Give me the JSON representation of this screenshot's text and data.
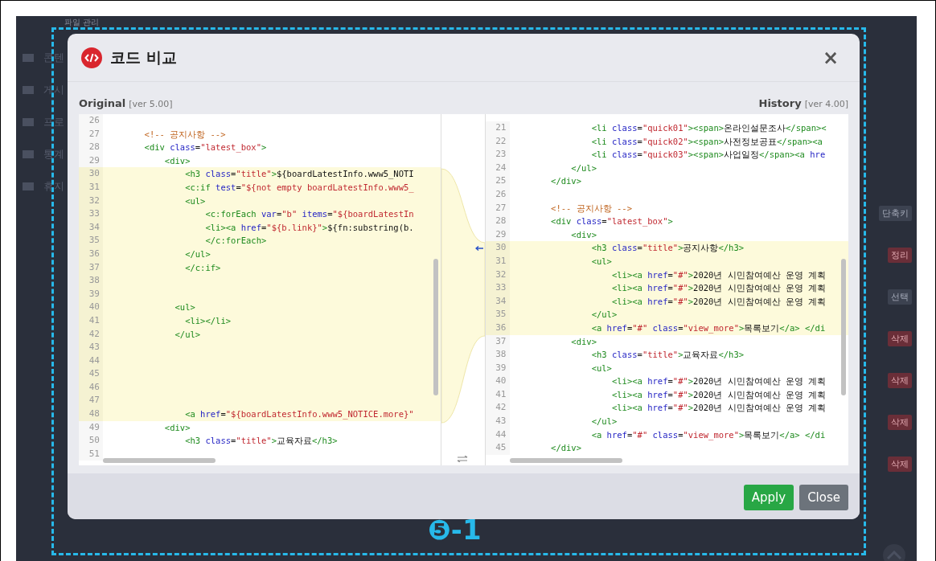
{
  "background": {
    "breadcrumb": "파일 관리",
    "sidebar": [
      {
        "label": "콘텐"
      },
      {
        "label": "게시"
      },
      {
        "label": "프로"
      },
      {
        "label": "통계"
      },
      {
        "label": "휴지"
      }
    ],
    "badges": [
      {
        "label": "단축키",
        "kind": "neutral"
      },
      {
        "label": "정리",
        "kind": "danger"
      },
      {
        "label": "선택",
        "kind": "neutral"
      },
      {
        "label": "삭제",
        "kind": "danger"
      },
      {
        "label": "삭제",
        "kind": "danger"
      },
      {
        "label": "삭제",
        "kind": "danger"
      },
      {
        "label": "삭제",
        "kind": "danger"
      }
    ]
  },
  "dialog": {
    "title": "코드 비교",
    "close": "×",
    "panes": [
      {
        "title": "Original",
        "version": "[ver 5.00]",
        "lines": [
          {
            "num": "26",
            "changed": false
          },
          {
            "num": "27",
            "changed": false,
            "tokens": [
              {
                "kind": "cmt",
                "s": "        <!-- 공지사항 -->"
              }
            ]
          },
          {
            "num": "28",
            "changed": false,
            "tokens": [
              {
                "kind": "tag",
                "s": "        <div "
              },
              {
                "kind": "attr",
                "s": "class"
              },
              {
                "kind": "txt",
                "s": "="
              },
              {
                "kind": "str",
                "s": "\"latest_box\""
              },
              {
                "kind": "tag",
                "s": ">"
              }
            ]
          },
          {
            "num": "29",
            "changed": false,
            "tokens": [
              {
                "kind": "tag",
                "s": "            <div>"
              }
            ]
          },
          {
            "num": "30",
            "changed": true,
            "tokens": [
              {
                "kind": "tag",
                "s": "                <h3 "
              },
              {
                "kind": "attr",
                "s": "class"
              },
              {
                "kind": "txt",
                "s": "="
              },
              {
                "kind": "str",
                "s": "\"title\""
              },
              {
                "kind": "tag",
                "s": ">"
              },
              {
                "kind": "txt",
                "s": "${boardLatestInfo.www5_NOTI"
              }
            ]
          },
          {
            "num": "31",
            "changed": true,
            "tokens": [
              {
                "kind": "tag",
                "s": "                <c:if "
              },
              {
                "kind": "attr",
                "s": "test"
              },
              {
                "kind": "txt",
                "s": "="
              },
              {
                "kind": "str",
                "s": "\"${not empty boardLatestInfo.www5_"
              }
            ]
          },
          {
            "num": "32",
            "changed": true,
            "tokens": [
              {
                "kind": "tag",
                "s": "                <ul>"
              }
            ]
          },
          {
            "num": "33",
            "changed": true,
            "tokens": [
              {
                "kind": "tag",
                "s": "                    <c:forEach "
              },
              {
                "kind": "attr",
                "s": "var"
              },
              {
                "kind": "txt",
                "s": "="
              },
              {
                "kind": "str",
                "s": "\"b\" "
              },
              {
                "kind": "attr",
                "s": "items"
              },
              {
                "kind": "txt",
                "s": "="
              },
              {
                "kind": "str",
                "s": "\"${boardLatestIn"
              }
            ]
          },
          {
            "num": "34",
            "changed": true,
            "tokens": [
              {
                "kind": "tag",
                "s": "                    <li><a "
              },
              {
                "kind": "attr",
                "s": "href"
              },
              {
                "kind": "txt",
                "s": "="
              },
              {
                "kind": "str",
                "s": "\"${b.link}\""
              },
              {
                "kind": "tag",
                "s": ">"
              },
              {
                "kind": "txt",
                "s": "${fn:substring(b."
              }
            ]
          },
          {
            "num": "35",
            "changed": true,
            "tokens": [
              {
                "kind": "tag",
                "s": "                    </c:forEach>"
              }
            ]
          },
          {
            "num": "36",
            "changed": true,
            "tokens": [
              {
                "kind": "tag",
                "s": "                </ul>"
              }
            ]
          },
          {
            "num": "37",
            "changed": true,
            "tokens": [
              {
                "kind": "tag",
                "s": "                </c:if>"
              }
            ]
          },
          {
            "num": "38",
            "changed": true
          },
          {
            "num": "39",
            "changed": true
          },
          {
            "num": "40",
            "changed": true,
            "tokens": [
              {
                "kind": "tag",
                "s": "              <ul>"
              }
            ]
          },
          {
            "num": "41",
            "changed": true,
            "tokens": [
              {
                "kind": "tag",
                "s": "                <li></li>"
              }
            ]
          },
          {
            "num": "42",
            "changed": true,
            "tokens": [
              {
                "kind": "tag",
                "s": "              </ul>"
              }
            ]
          },
          {
            "num": "43",
            "changed": true
          },
          {
            "num": "44",
            "changed": true
          },
          {
            "num": "45",
            "changed": true
          },
          {
            "num": "46",
            "changed": true
          },
          {
            "num": "47",
            "changed": true
          },
          {
            "num": "48",
            "changed": true,
            "tokens": [
              {
                "kind": "tag",
                "s": "                <a "
              },
              {
                "kind": "attr",
                "s": "href"
              },
              {
                "kind": "txt",
                "s": "="
              },
              {
                "kind": "str",
                "s": "\"${boardLatestInfo.www5_NOTICE.more}\""
              }
            ]
          },
          {
            "num": "49",
            "changed": false,
            "tokens": [
              {
                "kind": "tag",
                "s": "            <div>"
              }
            ]
          },
          {
            "num": "50",
            "changed": false,
            "tokens": [
              {
                "kind": "tag",
                "s": "                <h3 "
              },
              {
                "kind": "attr",
                "s": "class"
              },
              {
                "kind": "txt",
                "s": "="
              },
              {
                "kind": "str",
                "s": "\"title\""
              },
              {
                "kind": "tag",
                "s": ">"
              },
              {
                "kind": "txt",
                "s": "교육자료"
              },
              {
                "kind": "tag",
                "s": "</h3>"
              }
            ]
          },
          {
            "num": "51",
            "changed": false
          }
        ]
      },
      {
        "title": "History",
        "version": "[ver 4.00]",
        "lines": [
          {
            "num": "21",
            "changed": false,
            "tokens": [
              {
                "kind": "tag",
                "s": "                <li "
              },
              {
                "kind": "attr",
                "s": "class"
              },
              {
                "kind": "txt",
                "s": "="
              },
              {
                "kind": "str",
                "s": "\"quick01\""
              },
              {
                "kind": "tag",
                "s": "><span>"
              },
              {
                "kind": "txt",
                "s": "온라인설문조사"
              },
              {
                "kind": "tag",
                "s": "</span><"
              }
            ]
          },
          {
            "num": "22",
            "changed": false,
            "tokens": [
              {
                "kind": "tag",
                "s": "                <li "
              },
              {
                "kind": "attr",
                "s": "class"
              },
              {
                "kind": "txt",
                "s": "="
              },
              {
                "kind": "str",
                "s": "\"quick02\""
              },
              {
                "kind": "tag",
                "s": "><span>"
              },
              {
                "kind": "txt",
                "s": "사전정보공표"
              },
              {
                "kind": "tag",
                "s": "</span><a"
              }
            ]
          },
          {
            "num": "23",
            "changed": false,
            "tokens": [
              {
                "kind": "tag",
                "s": "                <li "
              },
              {
                "kind": "attr",
                "s": "class"
              },
              {
                "kind": "txt",
                "s": "="
              },
              {
                "kind": "str",
                "s": "\"quick03\""
              },
              {
                "kind": "tag",
                "s": "><span>"
              },
              {
                "kind": "txt",
                "s": "사업일정"
              },
              {
                "kind": "tag",
                "s": "</span><a "
              },
              {
                "kind": "attr",
                "s": "hre"
              }
            ]
          },
          {
            "num": "24",
            "changed": false,
            "tokens": [
              {
                "kind": "tag",
                "s": "            </ul>"
              }
            ]
          },
          {
            "num": "25",
            "changed": false,
            "tokens": [
              {
                "kind": "tag",
                "s": "        </div>"
              }
            ]
          },
          {
            "num": "26",
            "changed": false
          },
          {
            "num": "27",
            "changed": false,
            "tokens": [
              {
                "kind": "cmt",
                "s": "        <!-- 공지사항 -->"
              }
            ]
          },
          {
            "num": "28",
            "changed": false,
            "tokens": [
              {
                "kind": "tag",
                "s": "        <div "
              },
              {
                "kind": "attr",
                "s": "class"
              },
              {
                "kind": "txt",
                "s": "="
              },
              {
                "kind": "str",
                "s": "\"latest_box\""
              },
              {
                "kind": "tag",
                "s": ">"
              }
            ]
          },
          {
            "num": "29",
            "changed": false,
            "tokens": [
              {
                "kind": "tag",
                "s": "            <div>"
              }
            ]
          },
          {
            "num": "30",
            "changed": true,
            "tokens": [
              {
                "kind": "tag",
                "s": "                <h3 "
              },
              {
                "kind": "attr",
                "s": "class"
              },
              {
                "kind": "txt",
                "s": "="
              },
              {
                "kind": "str",
                "s": "\"title\""
              },
              {
                "kind": "tag",
                "s": ">"
              },
              {
                "kind": "txt",
                "s": "공지사항"
              },
              {
                "kind": "tag",
                "s": "</h3>"
              }
            ]
          },
          {
            "num": "31",
            "changed": true,
            "tokens": [
              {
                "kind": "tag",
                "s": "                <ul>"
              }
            ]
          },
          {
            "num": "32",
            "changed": true,
            "tokens": [
              {
                "kind": "tag",
                "s": "                    <li><a "
              },
              {
                "kind": "attr",
                "s": "href"
              },
              {
                "kind": "txt",
                "s": "="
              },
              {
                "kind": "str",
                "s": "\"#\""
              },
              {
                "kind": "tag",
                "s": ">"
              },
              {
                "kind": "txt",
                "s": "2020년 시민참여예산 운영 계획"
              }
            ]
          },
          {
            "num": "33",
            "changed": true,
            "tokens": [
              {
                "kind": "tag",
                "s": "                    <li><a "
              },
              {
                "kind": "attr",
                "s": "href"
              },
              {
                "kind": "txt",
                "s": "="
              },
              {
                "kind": "str",
                "s": "\"#\""
              },
              {
                "kind": "tag",
                "s": ">"
              },
              {
                "kind": "txt",
                "s": "2020년 시민참여예산 운영 계획"
              }
            ]
          },
          {
            "num": "34",
            "changed": true,
            "tokens": [
              {
                "kind": "tag",
                "s": "                    <li><a "
              },
              {
                "kind": "attr",
                "s": "href"
              },
              {
                "kind": "txt",
                "s": "="
              },
              {
                "kind": "str",
                "s": "\"#\""
              },
              {
                "kind": "tag",
                "s": ">"
              },
              {
                "kind": "txt",
                "s": "2020년 시민참여예산 운영 계획"
              }
            ]
          },
          {
            "num": "35",
            "changed": true,
            "tokens": [
              {
                "kind": "tag",
                "s": "                </ul>"
              }
            ]
          },
          {
            "num": "36",
            "changed": true,
            "tokens": [
              {
                "kind": "tag",
                "s": "                <a "
              },
              {
                "kind": "attr",
                "s": "href"
              },
              {
                "kind": "txt",
                "s": "="
              },
              {
                "kind": "str",
                "s": "\"#\" "
              },
              {
                "kind": "attr",
                "s": "class"
              },
              {
                "kind": "txt",
                "s": "="
              },
              {
                "kind": "str",
                "s": "\"view_more\""
              },
              {
                "kind": "tag",
                "s": ">"
              },
              {
                "kind": "txt",
                "s": "목록보기"
              },
              {
                "kind": "tag",
                "s": "</a> </di"
              }
            ]
          },
          {
            "num": "37",
            "changed": false,
            "tokens": [
              {
                "kind": "tag",
                "s": "            <div>"
              }
            ]
          },
          {
            "num": "38",
            "changed": false,
            "tokens": [
              {
                "kind": "tag",
                "s": "                <h3 "
              },
              {
                "kind": "attr",
                "s": "class"
              },
              {
                "kind": "txt",
                "s": "="
              },
              {
                "kind": "str",
                "s": "\"title\""
              },
              {
                "kind": "tag",
                "s": ">"
              },
              {
                "kind": "txt",
                "s": "교육자료"
              },
              {
                "kind": "tag",
                "s": "</h3>"
              }
            ]
          },
          {
            "num": "39",
            "changed": false,
            "tokens": [
              {
                "kind": "tag",
                "s": "                <ul>"
              }
            ]
          },
          {
            "num": "40",
            "changed": false,
            "tokens": [
              {
                "kind": "tag",
                "s": "                    <li><a "
              },
              {
                "kind": "attr",
                "s": "href"
              },
              {
                "kind": "txt",
                "s": "="
              },
              {
                "kind": "str",
                "s": "\"#\""
              },
              {
                "kind": "tag",
                "s": ">"
              },
              {
                "kind": "txt",
                "s": "2020년 시민참여예산 운영 계획"
              }
            ]
          },
          {
            "num": "41",
            "changed": false,
            "tokens": [
              {
                "kind": "tag",
                "s": "                    <li><a "
              },
              {
                "kind": "attr",
                "s": "href"
              },
              {
                "kind": "txt",
                "s": "="
              },
              {
                "kind": "str",
                "s": "\"#\""
              },
              {
                "kind": "tag",
                "s": ">"
              },
              {
                "kind": "txt",
                "s": "2020년 시민참여예산 운영 계획"
              }
            ]
          },
          {
            "num": "42",
            "changed": false,
            "tokens": [
              {
                "kind": "tag",
                "s": "                    <li><a "
              },
              {
                "kind": "attr",
                "s": "href"
              },
              {
                "kind": "txt",
                "s": "="
              },
              {
                "kind": "str",
                "s": "\"#\""
              },
              {
                "kind": "tag",
                "s": ">"
              },
              {
                "kind": "txt",
                "s": "2020년 시민참여예산 운영 계획"
              }
            ]
          },
          {
            "num": "43",
            "changed": false,
            "tokens": [
              {
                "kind": "tag",
                "s": "                </ul>"
              }
            ]
          },
          {
            "num": "44",
            "changed": false,
            "tokens": [
              {
                "kind": "tag",
                "s": "                <a "
              },
              {
                "kind": "attr",
                "s": "href"
              },
              {
                "kind": "txt",
                "s": "="
              },
              {
                "kind": "str",
                "s": "\"#\" "
              },
              {
                "kind": "attr",
                "s": "class"
              },
              {
                "kind": "txt",
                "s": "="
              },
              {
                "kind": "str",
                "s": "\"view_more\""
              },
              {
                "kind": "tag",
                "s": ">"
              },
              {
                "kind": "txt",
                "s": "목록보기"
              },
              {
                "kind": "tag",
                "s": "</a> </di"
              }
            ]
          },
          {
            "num": "45",
            "changed": false,
            "tokens": [
              {
                "kind": "tag",
                "s": "        </div>"
              }
            ]
          }
        ]
      }
    ],
    "buttons": [
      {
        "label": "Apply",
        "kind": "primary"
      },
      {
        "label": "Close",
        "kind": "secondary"
      }
    ]
  },
  "annotation": {
    "label": "❺-1"
  }
}
